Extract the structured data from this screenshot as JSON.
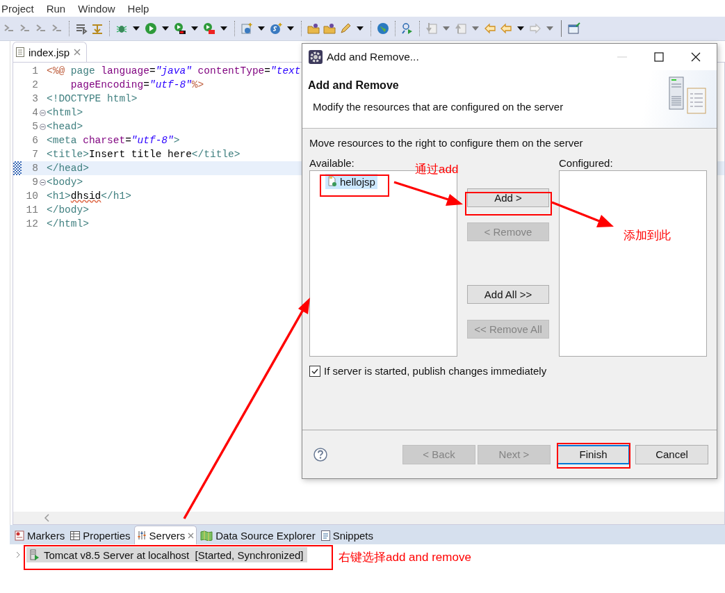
{
  "menu": [
    {
      "label": "Project"
    },
    {
      "label": "Run"
    },
    {
      "label": "Window"
    },
    {
      "label": "Help"
    }
  ],
  "editor": {
    "tab": {
      "label": "index.jsp",
      "selected": true
    },
    "lines": [
      {
        "number": "1",
        "fold": false,
        "current": false,
        "tokens": [
          {
            "kind": "directive",
            "text": "<%@"
          },
          {
            "kind": "markup",
            "text": " page"
          },
          {
            "kind": "attr",
            "text": " language"
          },
          {
            "kind": "plain",
            "text": "="
          },
          {
            "kind": "string",
            "text": "\"java\""
          },
          {
            "kind": "attr",
            "text": " contentType"
          },
          {
            "kind": "plain",
            "text": "="
          },
          {
            "kind": "string",
            "text": "\"text"
          }
        ]
      },
      {
        "number": "2",
        "fold": false,
        "current": false,
        "tokens": [
          {
            "kind": "attr",
            "text": "    pageEncoding"
          },
          {
            "kind": "plain",
            "text": "="
          },
          {
            "kind": "string",
            "text": "\"utf-8\""
          },
          {
            "kind": "directive",
            "text": "%>"
          }
        ]
      },
      {
        "number": "3",
        "fold": false,
        "current": false,
        "tokens": [
          {
            "kind": "markup",
            "text": "<!DOCTYPE html>"
          }
        ]
      },
      {
        "number": "4",
        "fold": true,
        "current": false,
        "tokens": [
          {
            "kind": "markup",
            "text": "<html>"
          }
        ]
      },
      {
        "number": "5",
        "fold": true,
        "current": false,
        "tokens": [
          {
            "kind": "markup",
            "text": "<head>"
          }
        ]
      },
      {
        "number": "6",
        "fold": false,
        "current": false,
        "tokens": [
          {
            "kind": "markup",
            "text": "<meta"
          },
          {
            "kind": "attr",
            "text": " charset"
          },
          {
            "kind": "plain",
            "text": "="
          },
          {
            "kind": "string",
            "text": "\"utf-8\""
          },
          {
            "kind": "markup",
            "text": ">"
          }
        ]
      },
      {
        "number": "7",
        "fold": false,
        "current": false,
        "tokens": [
          {
            "kind": "markup",
            "text": "<title>"
          },
          {
            "kind": "text",
            "text": "Insert title here"
          },
          {
            "kind": "markup",
            "text": "</title>"
          }
        ]
      },
      {
        "number": "8",
        "fold": false,
        "current": true,
        "tokens": [
          {
            "kind": "markup",
            "text": "</head>"
          }
        ]
      },
      {
        "number": "9",
        "fold": true,
        "current": false,
        "tokens": [
          {
            "kind": "markup",
            "text": "<body>"
          }
        ]
      },
      {
        "number": "10",
        "fold": false,
        "current": false,
        "tokens": [
          {
            "kind": "markup",
            "text": "<h1>"
          },
          {
            "kind": "misspelled",
            "text": "dhsid"
          },
          {
            "kind": "markup",
            "text": "</h1>"
          }
        ]
      },
      {
        "number": "11",
        "fold": false,
        "current": false,
        "tokens": [
          {
            "kind": "markup",
            "text": "</body>"
          }
        ]
      },
      {
        "number": "12",
        "fold": false,
        "current": false,
        "tokens": [
          {
            "kind": "markup",
            "text": "</html>"
          }
        ]
      }
    ]
  },
  "bottom_panel": {
    "tabs": [
      {
        "label": "Markers",
        "selected": false
      },
      {
        "label": "Properties",
        "selected": false
      },
      {
        "label": "Servers",
        "selected": true
      },
      {
        "label": "Data Source Explorer",
        "selected": false
      },
      {
        "label": "Snippets",
        "selected": false
      }
    ],
    "servers": [
      {
        "label": "Tomcat v8.5 Server at localhost  [Started, Synchronized]",
        "selected": true,
        "expanded": false
      }
    ]
  },
  "dialog": {
    "title": "Add and Remove...",
    "heading": "Add and Remove",
    "description": "Modify the resources that are configured on the server",
    "instruction": "Move resources to the right to configure them on the server",
    "available": {
      "label": "Available:",
      "items": [
        {
          "label": "hellojsp",
          "selected": true
        }
      ]
    },
    "configured": {
      "label": "Configured:"
    },
    "buttons": [
      {
        "label": "Add >",
        "disabled": false
      },
      {
        "label": "< Remove",
        "disabled": true
      },
      {
        "label": "Add All >>",
        "disabled": false
      },
      {
        "label": "<< Remove All",
        "disabled": true
      }
    ],
    "publish": {
      "label": "If server is started, publish changes immediately",
      "checked": true
    },
    "footer_buttons": [
      {
        "label": "< Back",
        "disabled": true,
        "default": false
      },
      {
        "label": "Next >",
        "disabled": true,
        "default": false
      },
      {
        "label": "Finish",
        "disabled": false,
        "default": true
      },
      {
        "label": "Cancel",
        "disabled": false,
        "default": false
      }
    ]
  },
  "annotations": [
    {
      "text": "通过add"
    },
    {
      "text": "添加到此"
    },
    {
      "text": "右键选择add and remove"
    }
  ]
}
